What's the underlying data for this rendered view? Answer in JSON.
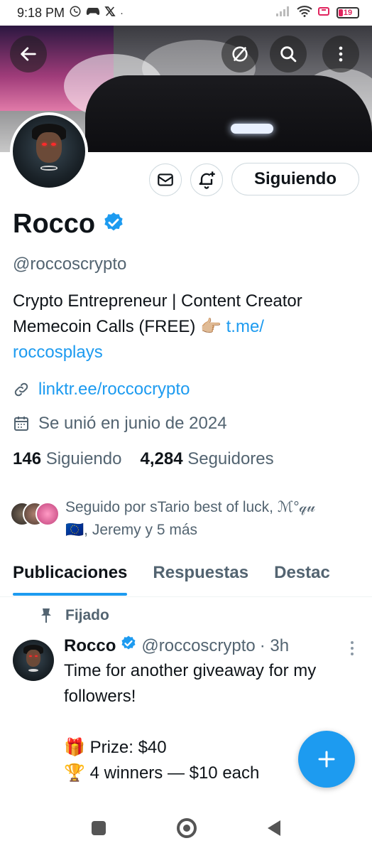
{
  "status_bar": {
    "time": "9:18 PM",
    "battery": "19",
    "apps": [
      "whatsapp-icon",
      "game-controller-icon",
      "x-logo-icon"
    ],
    "dot": "·"
  },
  "profile": {
    "name": "Rocco",
    "handle": "@roccoscrypto",
    "verified": true,
    "follow_button": "Siguiendo",
    "bio_line1": "Crypto Entrepreneur | Content Creator",
    "bio_line2_text": "Memecoin Calls (FREE)",
    "bio_emoji": "👉🏼",
    "bio_link_part1": "t.me/",
    "bio_link_part2": "roccosplays",
    "website": "linktr.ee/roccocrypto",
    "joined": "Se unió en junio de 2024",
    "following_count": "146",
    "following_label": "Siguiendo",
    "followers_count": "4,284",
    "followers_label": "Seguidores",
    "followed_by_line1": "Seguido por sTario best of luck, ℳ°𝓆𝓊",
    "followed_by_flag": "🇪🇺",
    "followed_by_line2": ", Jeremy y 5 más"
  },
  "tabs": [
    "Publicaciones",
    "Respuestas",
    "Destac"
  ],
  "post": {
    "pinned_label": "Fijado",
    "author": "Rocco",
    "handle": "@roccoscrypto",
    "time": "· 3h",
    "line1": "Time for another giveaway for my",
    "line2": "followers!",
    "prize_emoji": "🎁",
    "prize": "Prize: $40",
    "winners_emoji": "🏆",
    "winners": "4 winners — $10 each"
  },
  "colors": {
    "accent": "#1d9bf0",
    "text": "#0f1419",
    "secondary": "#536471"
  }
}
